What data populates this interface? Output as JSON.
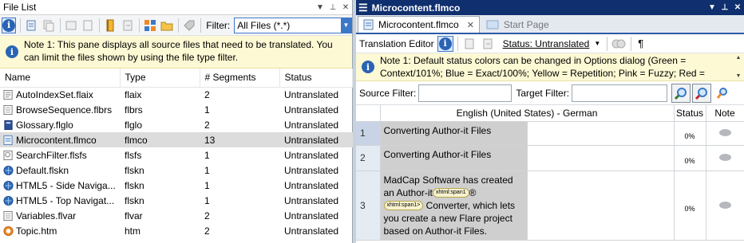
{
  "left_pane": {
    "title": "File List",
    "filter_label": "Filter:",
    "filter_value": "All Files (*.*)",
    "note": "Note 1: This pane displays all source files that need to be translated. You can limit the files shown by using the file type filter.",
    "columns": [
      "Name",
      "Type",
      "# Segments",
      "Status"
    ],
    "files": [
      {
        "name": "AutoIndexSet.flaix",
        "type": "flaix",
        "segments": "2",
        "status": "Untranslated",
        "icon": "index-file-icon",
        "selected": false
      },
      {
        "name": "BrowseSequence.flbrs",
        "type": "flbrs",
        "segments": "1",
        "status": "Untranslated",
        "icon": "browse-sequence-icon",
        "selected": false
      },
      {
        "name": "Glossary.flglo",
        "type": "flglo",
        "segments": "2",
        "status": "Untranslated",
        "icon": "glossary-icon",
        "selected": false
      },
      {
        "name": "Microcontent.flmco",
        "type": "flmco",
        "segments": "13",
        "status": "Untranslated",
        "icon": "microcontent-file-icon",
        "selected": true
      },
      {
        "name": "SearchFilter.flsfs",
        "type": "flsfs",
        "segments": "1",
        "status": "Untranslated",
        "icon": "search-filter-icon",
        "selected": false
      },
      {
        "name": "Default.flskn",
        "type": "flskn",
        "segments": "1",
        "status": "Untranslated",
        "icon": "skin-icon",
        "selected": false
      },
      {
        "name": "HTML5 - Side Naviga...",
        "type": "flskn",
        "segments": "1",
        "status": "Untranslated",
        "icon": "skin-icon",
        "selected": false
      },
      {
        "name": "HTML5 - Top Navigat...",
        "type": "flskn",
        "segments": "1",
        "status": "Untranslated",
        "icon": "skin-icon",
        "selected": false
      },
      {
        "name": "Variables.flvar",
        "type": "flvar",
        "segments": "2",
        "status": "Untranslated",
        "icon": "variables-icon",
        "selected": false
      },
      {
        "name": "Topic.htm",
        "type": "htm",
        "segments": "2",
        "status": "Untranslated",
        "icon": "html-topic-icon",
        "selected": false
      }
    ]
  },
  "right_pane": {
    "title": "Microcontent.flmco",
    "tabs": [
      {
        "label": "Microcontent.flmco",
        "active": true
      },
      {
        "label": "Start Page",
        "active": false
      }
    ],
    "toolbar": {
      "editor_label": "Translation Editor",
      "status_label": "Status: Untranslated",
      "paragraph_symbol": "¶"
    },
    "note": "Note 1: Default status colors can be changed in Options dialog (Green = Context/101%; Blue = Exact/100%; Yellow = Repetition; Pink = Fuzzy; Red =",
    "source_filter_label": "Source Filter:",
    "target_filter_label": "Target Filter:",
    "grid": {
      "language_header": "English (United States) - German",
      "status_header": "Status",
      "note_header": "Note",
      "rows": [
        {
          "num": "1",
          "source": "Converting Author-it Files",
          "status": "0%"
        },
        {
          "num": "2",
          "source": "Converting Author-it Files",
          "status": "0%"
        },
        {
          "num": "3",
          "source_parts": {
            "a": "MadCap Software has created an Author-it",
            "tag1": "xhtml:span1",
            "b": "®",
            "tag2": "xhtml:span1>",
            "c": " Converter, which lets you create a new Flare project based on Author-it Files."
          },
          "status": "0%"
        }
      ]
    }
  },
  "colors": {
    "title_bar": "#0f2f6e",
    "accent": "#3d78c8",
    "note_bg": "#fdf9d4",
    "selected_row": "#dcdcdc",
    "source_cell": "#cfcfcf"
  }
}
